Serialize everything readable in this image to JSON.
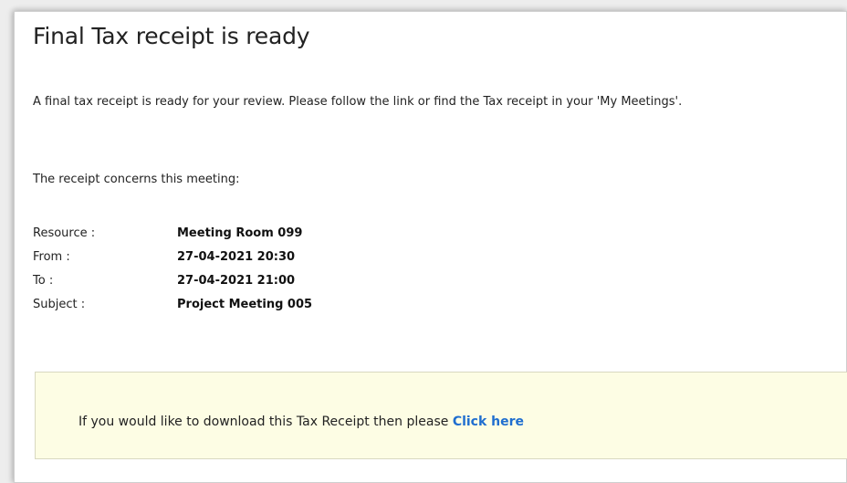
{
  "email": {
    "title": "Final Tax receipt is ready",
    "intro": "A final tax receipt is ready for your review. Please follow the link or find the Tax receipt in your 'My Meetings'.",
    "concerns": "The receipt concerns this meeting:",
    "details": [
      {
        "label": "Resource :",
        "value": "Meeting Room 099"
      },
      {
        "label": "From :",
        "value": "27-04-2021 20:30"
      },
      {
        "label": "To :",
        "value": "27-04-2021 21:00"
      },
      {
        "label": "Subject :",
        "value": "Project Meeting 005"
      }
    ],
    "download": {
      "text": "If you would like to download this Tax Receipt then please ",
      "link_label": "Click here"
    }
  },
  "colors": {
    "link": "#1f6ecf",
    "highlight_box": "#fdfde4"
  }
}
